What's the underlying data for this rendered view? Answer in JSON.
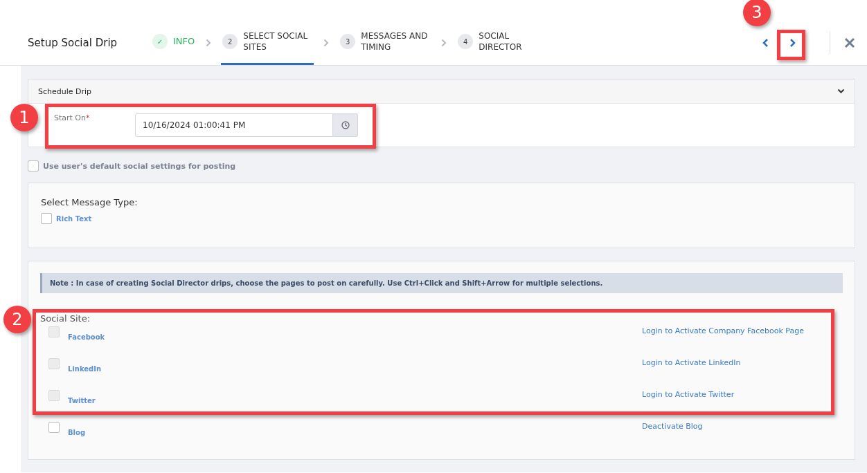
{
  "header": {
    "title": "Setup Social Drip",
    "steps": [
      {
        "marker": "✓",
        "label": "INFO",
        "kind": "done",
        "selected": false
      },
      {
        "marker": "2",
        "label": "SELECT SOCIAL SITES",
        "kind": "number",
        "selected": true
      },
      {
        "marker": "3",
        "label": "MESSAGES AND TIMING",
        "kind": "number",
        "selected": false
      },
      {
        "marker": "4",
        "label": "SOCIAL DIRECTOR",
        "kind": "number",
        "selected": false
      }
    ]
  },
  "schedule": {
    "title": "Schedule Drip",
    "label": "Start On",
    "required_mark": "*",
    "value": "10/16/2024 01:00:41 PM"
  },
  "default_settings": {
    "label": "Use user's default social settings for posting",
    "checked": false
  },
  "message_type": {
    "title": "Select Message Type:",
    "options": [
      {
        "label": "Rich Text",
        "checked": false
      }
    ]
  },
  "social": {
    "note_label": "Note :",
    "note": "In case of creating Social Director drips, choose the pages to post on carefully. Use Ctrl+Click and Shift+Arrow for multiple selections.",
    "title": "Social Site:",
    "sites": [
      {
        "name": "Facebook",
        "action": "Login to Activate Company Facebook Page",
        "checked": false,
        "disabled": true
      },
      {
        "name": "LinkedIn",
        "action": "Login to Activate LinkedIn",
        "checked": false,
        "disabled": true
      },
      {
        "name": "Twitter",
        "action": "Login to Activate Twitter",
        "checked": false,
        "disabled": true
      },
      {
        "name": "Blog",
        "action": "Deactivate Blog",
        "checked": false,
        "disabled": false
      }
    ]
  },
  "annotations": [
    {
      "number": "1"
    },
    {
      "number": "2"
    },
    {
      "number": "3"
    }
  ]
}
